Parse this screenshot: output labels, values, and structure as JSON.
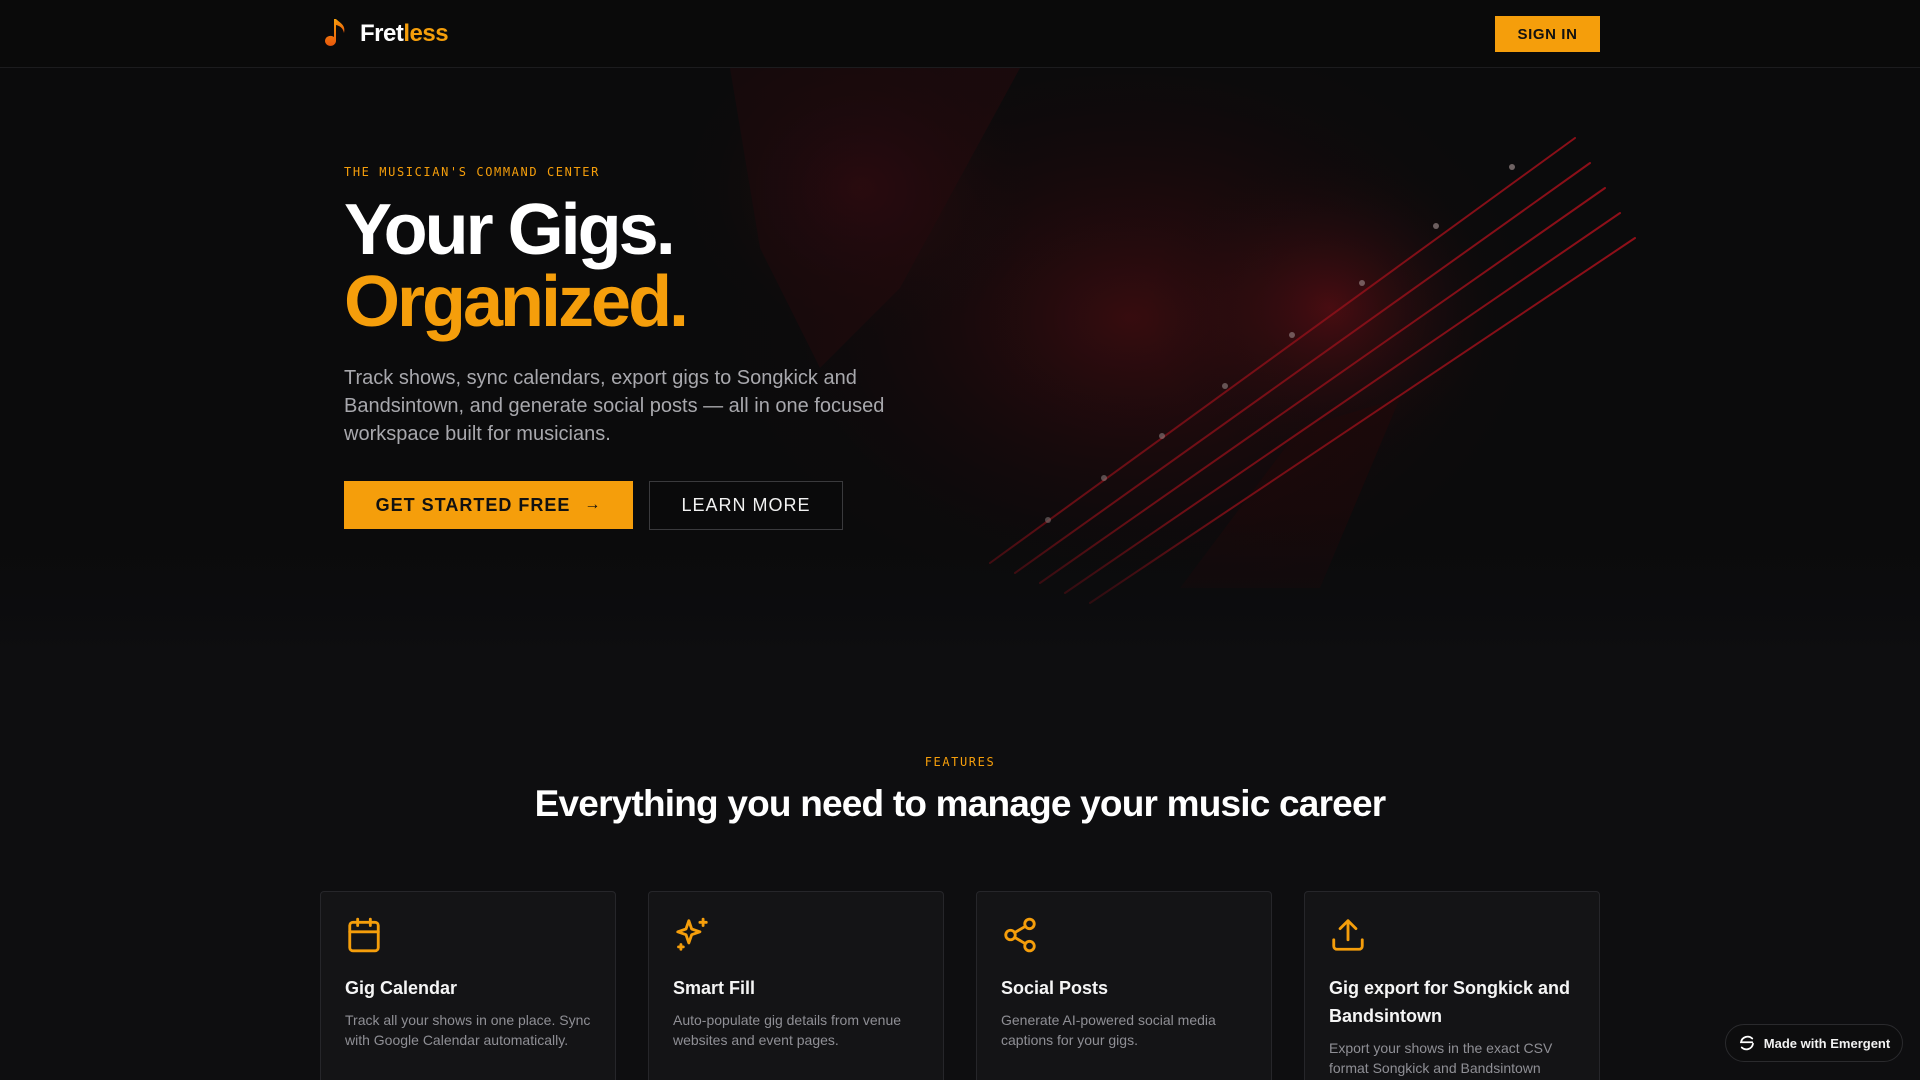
{
  "nav": {
    "brand_part1": "Fret",
    "brand_part2": "less",
    "brand_icon": "music-note-icon",
    "signin_label": "SIGN IN"
  },
  "hero": {
    "eyebrow": "THE MUSICIAN'S COMMAND CENTER",
    "title_line1": "Your Gigs.",
    "title_line2": "Organized.",
    "description": "Track shows, sync calendars, export gigs to Songkick and Bandsintown, and generate social posts — all in one focused workspace built for musicians.",
    "cta_label": "GET STARTED FREE",
    "cta_icon": "arrow-right-icon",
    "secondary_label": "LEARN MORE"
  },
  "features": {
    "eyebrow": "FEATURES",
    "title": "Everything you need to manage your music career",
    "cards": [
      {
        "icon": "calendar-icon",
        "title": "Gig Calendar",
        "description": "Track all your shows in one place. Sync with Google Calendar automatically."
      },
      {
        "icon": "sparkles-icon",
        "title": "Smart Fill",
        "description": "Auto-populate gig details from venue websites and event pages."
      },
      {
        "icon": "share-icon",
        "title": "Social Posts",
        "description": "Generate AI-powered social media captions for your gigs."
      },
      {
        "icon": "upload-icon",
        "title": "Gig export for Songkick and Bandsintown",
        "description": "Export your shows in the exact CSV format Songkick and Bandsintown"
      }
    ]
  },
  "badge": {
    "label": "Made with Emergent",
    "icon": "emergent-logo-icon"
  },
  "colors": {
    "accent": "#f59e0b",
    "background": "#0a0a0b",
    "card": "#141416",
    "muted_text": "#a8a8ad"
  }
}
